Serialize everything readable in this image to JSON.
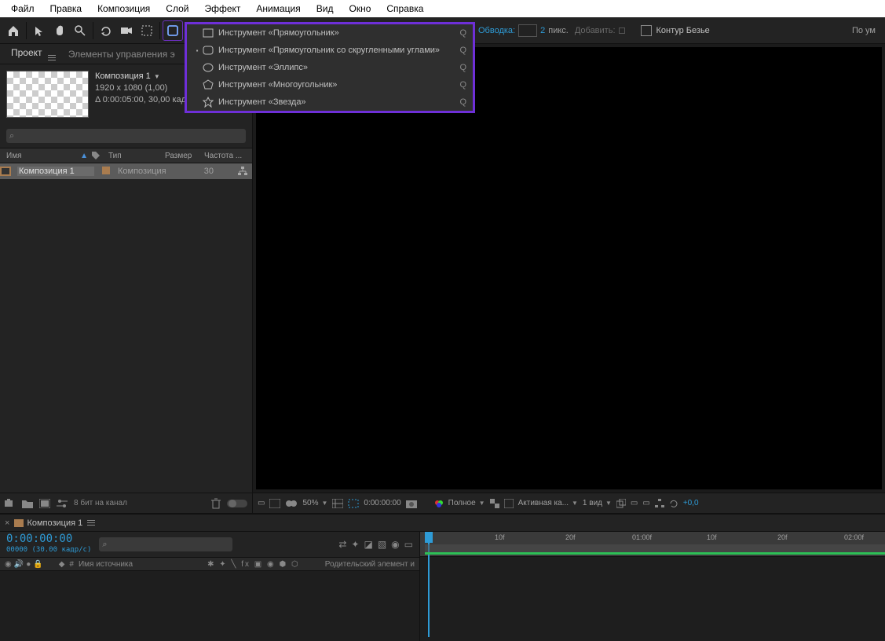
{
  "menubar": {
    "items": [
      "Файл",
      "Правка",
      "Композиция",
      "Слой",
      "Эффект",
      "Анимация",
      "Вид",
      "Окно",
      "Справка"
    ]
  },
  "toolbar": {
    "stroke_label": "Обводка:",
    "stroke_value": "2",
    "stroke_unit": "пикс.",
    "add_label": "Добавить:",
    "bezier_label": "Контур Безье",
    "workspace": "По ум"
  },
  "shape_flyout": {
    "items": [
      {
        "label": "Инструмент «Прямоугольник»",
        "shortcut": "Q",
        "indicator": ""
      },
      {
        "label": "Инструмент «Прямоугольник со скругленными углами»",
        "shortcut": "Q",
        "indicator": "▪"
      },
      {
        "label": "Инструмент «Эллипс»",
        "shortcut": "Q",
        "indicator": ""
      },
      {
        "label": "Инструмент «Многоугольник»",
        "shortcut": "Q",
        "indicator": ""
      },
      {
        "label": "Инструмент «Звезда»",
        "shortcut": "Q",
        "indicator": ""
      }
    ]
  },
  "project": {
    "tab_active": "Проект",
    "tab_inactive": "Элементы управления э",
    "comp": {
      "name": "Композиция 1",
      "dimensions": "1920 x 1080 (1,00)",
      "duration": "Δ 0:00:05:00, 30,00 кад"
    },
    "headers": {
      "name": "Имя",
      "type": "Тип",
      "size": "Размер",
      "freq": "Частота ..."
    },
    "row": {
      "name": "Композиция 1",
      "type": "Композиция",
      "size": "30"
    },
    "footer": {
      "bpc": "8 бит на канал"
    },
    "search_placeholder": ""
  },
  "viewer": {
    "footer": {
      "zoom": "50%",
      "timecode": "0:00:00:00",
      "res": "Полное",
      "camera": "Активная ка...",
      "view": "1 вид",
      "exp": "+0,0"
    }
  },
  "timeline": {
    "tab": "Композиция 1",
    "timecode": "0:00:00:00",
    "timecode_sub": "00000 (30.00 кадр/с)",
    "headers": {
      "hash": "#",
      "source_name": "Имя источника",
      "parent": "Родительский элемент и"
    },
    "ruler": [
      "10f",
      "20f",
      "01:00f",
      "10f",
      "20f",
      "02:00f"
    ],
    "search_placeholder": ""
  }
}
